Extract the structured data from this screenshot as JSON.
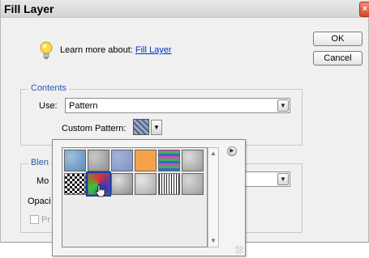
{
  "dialog": {
    "title": "Fill Layer",
    "close_symbol": "×",
    "learn_text": "Learn more about:",
    "learn_link": "Fill Layer",
    "ok_label": "OK",
    "cancel_label": "Cancel"
  },
  "contents": {
    "legend": "Contents",
    "use_label": "Use:",
    "use_value": "Pattern",
    "custom_pattern_label": "Custom Pattern:"
  },
  "blending": {
    "legend_partial": "Blen",
    "mode_partial": "Mo",
    "opacity_partial": "Opaci",
    "preserve_partial": "Pr"
  },
  "pattern_picker": {
    "selected_index": 7,
    "swatches": [
      {
        "name": "bubbles",
        "colors": [
          "#5d8ab5",
          "#9ec1de"
        ]
      },
      {
        "name": "wrinkles",
        "colors": [
          "#8e8e8e",
          "#c8c8c8"
        ]
      },
      {
        "name": "blue-fabric",
        "colors": [
          "#7f94c4",
          "#a3b3d8"
        ]
      },
      {
        "name": "orange",
        "colors": [
          "#f5a24a",
          "#f9b36a"
        ]
      },
      {
        "name": "rainbow-stripes",
        "colors": [
          "#2d6fc0",
          "#44b254",
          "#d34bb8"
        ]
      },
      {
        "name": "gray-noise",
        "colors": [
          "#9a9a9a",
          "#dcdcdc"
        ]
      },
      {
        "name": "checker-bw",
        "colors": [
          "#111111",
          "#ffffff"
        ]
      },
      {
        "name": "tie-dye",
        "colors": [
          "#d33",
          "#33c",
          "#3c3"
        ]
      },
      {
        "name": "gray-granite",
        "colors": [
          "#8a8a8a",
          "#e0e0e0"
        ]
      },
      {
        "name": "gray-mottled",
        "colors": [
          "#a8a8a8",
          "#e6e6e6"
        ]
      },
      {
        "name": "stripes-bw",
        "colors": [
          "#222222",
          "#ffffff"
        ]
      },
      {
        "name": "gray-clouds",
        "colors": [
          "#9c9c9c",
          "#d8d8d8"
        ]
      }
    ]
  },
  "colors": {
    "accent_legend": "#2a56b0",
    "link": "#0033cc",
    "close_red": "#d9482a"
  }
}
